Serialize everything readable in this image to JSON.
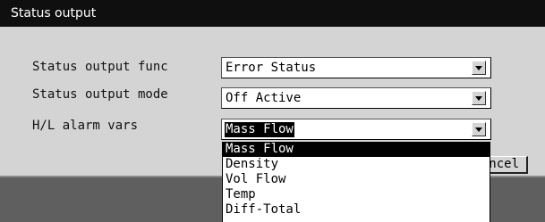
{
  "window": {
    "title": "Status output"
  },
  "fields": [
    {
      "label": "Status output func",
      "value": "Error Status"
    },
    {
      "label": "Status output mode",
      "value": "Off Active"
    },
    {
      "label": "H/L alarm vars",
      "value": "Mass Flow"
    }
  ],
  "dropdown": {
    "items": [
      "Mass Flow",
      "Density",
      "Vol Flow",
      "Temp",
      "Diff-Total"
    ],
    "highlighted_index": 0
  },
  "buttons": {
    "cancel_label": "Cancel"
  },
  "colors": {
    "titlebar": "#0f0f0f",
    "dialog": "#d4d4d4",
    "background": "#5f5f5f",
    "highlight": "#000000"
  },
  "icons": {
    "dropdown_arrow": "chevron-down-icon"
  }
}
